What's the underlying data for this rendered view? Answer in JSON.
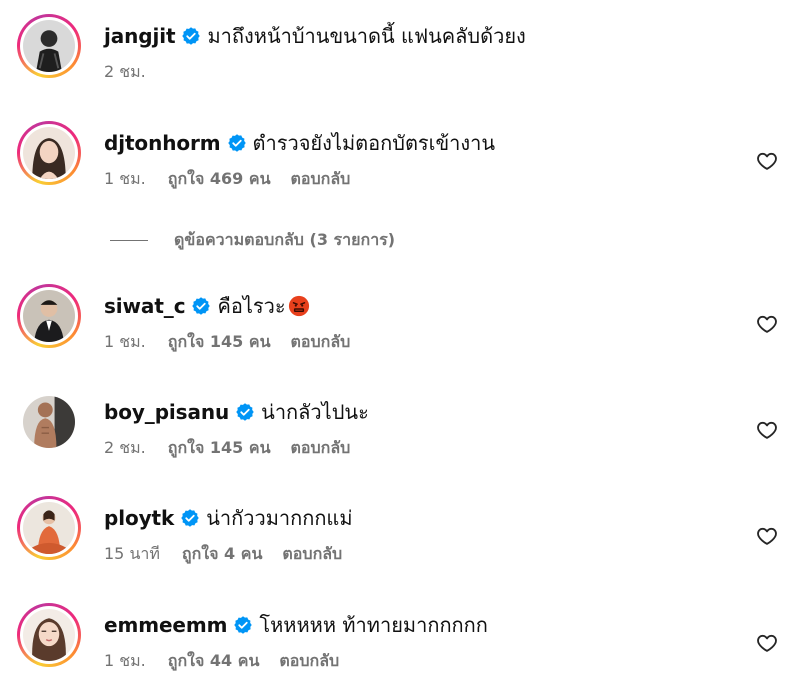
{
  "comments": [
    {
      "username": "jangjit",
      "text": "มาถึงหน้าบ้านขนาดนี้ แฟนคลับด้วยง",
      "time": "2 ชม.",
      "likes": "",
      "reply": "",
      "verified": true
    },
    {
      "username": "djtonhorm",
      "text": "ตำรวจยังไม่ตอกบัตรเข้างาน",
      "time": "1 ชม.",
      "likes": "ถูกใจ 469 คน",
      "reply": "ตอบกลับ",
      "verified": true
    },
    {
      "username": "siwat_c",
      "text": "คือไรวะ",
      "time": "1 ชม.",
      "likes": "ถูกใจ 145 คน",
      "reply": "ตอบกลับ",
      "verified": true,
      "emoji": "angry-face-emoji"
    },
    {
      "username": "boy_pisanu",
      "text": "น่ากลัวไปนะ",
      "time": "2 ชม.",
      "likes": "ถูกใจ 145 คน",
      "reply": "ตอบกลับ",
      "verified": true
    },
    {
      "username": "ploytk",
      "text": "น่ากัววมากกกแม่",
      "time": "15 นาที",
      "likes": "ถูกใจ 4 คน",
      "reply": "ตอบกลับ",
      "verified": true
    },
    {
      "username": "emmeemm",
      "text": "โหหหหห ท้าทายมากกกกก",
      "time": "1 ชม.",
      "likes": "ถูกใจ 44 คน",
      "reply": "ตอบกลับ",
      "verified": true
    }
  ],
  "view_replies": {
    "label": "ดูข้อความตอบกลับ (3 รายการ)"
  },
  "colors": {
    "verified_blue": "#0095f6",
    "muted_text": "#737373",
    "story_ring": [
      "#f9ce34",
      "#ee2a7b",
      "#6228d7"
    ]
  },
  "icons": {
    "like": "heart-outline-icon",
    "verified": "verified-badge-icon"
  }
}
